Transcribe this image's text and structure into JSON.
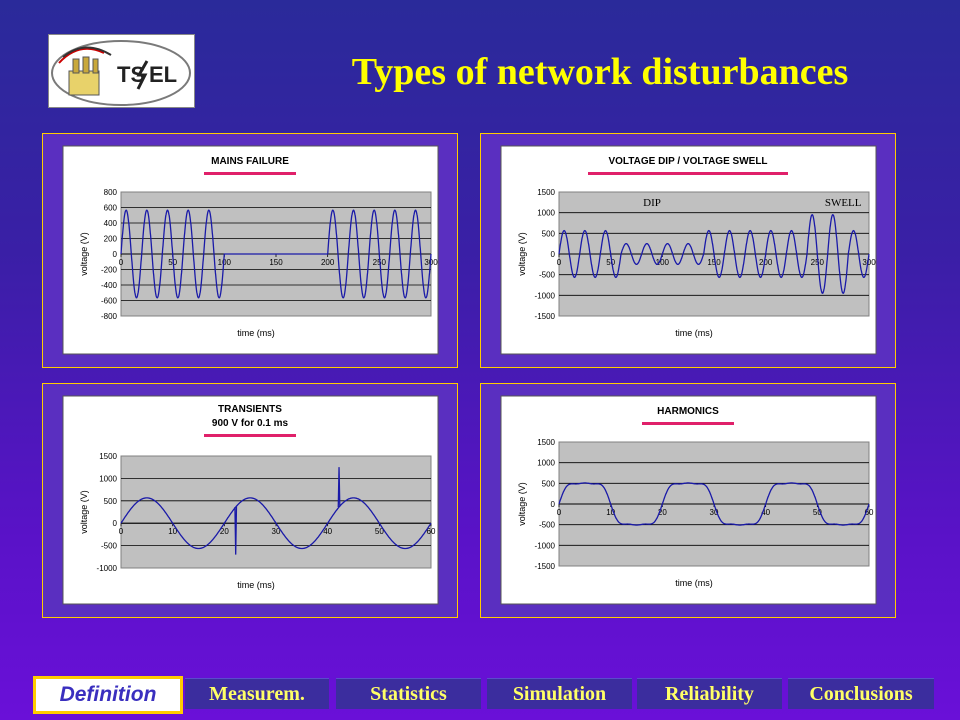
{
  "page": {
    "title": "Types of network disturbances",
    "logo_text": "TS",
    "logo_text2": "EL"
  },
  "nav": {
    "items": [
      "Definition",
      "Measurem.",
      "Statistics",
      "Simulation",
      "Reliability",
      "Conclusions"
    ],
    "active": "Definition"
  },
  "colors": {
    "background": "#4a18c0",
    "title": "#ffff00",
    "curve": "#1a1aa8",
    "title_underline": "#e0206a",
    "plot_area": "#c0c0c0",
    "nav_text": "#ffff66"
  },
  "chart_data": [
    {
      "type": "line",
      "title": "MAINS FAILURE",
      "title2": "",
      "xlabel": "time (ms)",
      "ylabel": "voltage (V)",
      "xlim": [
        0,
        300
      ],
      "ylim": [
        -800,
        800
      ],
      "xticks": [
        0,
        50,
        100,
        150,
        200,
        250,
        300
      ],
      "yticks": [
        800,
        600,
        400,
        200,
        0,
        -200,
        -400,
        -600,
        -800
      ],
      "grid": true,
      "legend": "none",
      "annotations": [],
      "series": [
        {
          "description": "50 Hz sine, amplitude 565 V, 0-100 ms; 0 V from 100 to 200 ms; sine resumes 200-300 ms",
          "frequency_hz": 50,
          "amplitude": 565,
          "segments": [
            [
              0,
              100,
              565
            ],
            [
              100,
              200,
              0
            ],
            [
              200,
              300,
              565
            ]
          ]
        }
      ]
    },
    {
      "type": "line",
      "title": "VOLTAGE DIP / VOLTAGE SWELL",
      "title2": "",
      "xlabel": "time (ms)",
      "ylabel": "voltage (V)",
      "xlim": [
        0,
        300
      ],
      "ylim": [
        -1500,
        1500
      ],
      "xticks": [
        0,
        50,
        100,
        150,
        200,
        250,
        300
      ],
      "yticks": [
        1500,
        1000,
        500,
        0,
        -500,
        -1000,
        -1500
      ],
      "grid": true,
      "legend": "none",
      "annotations": [
        {
          "text": "DIP",
          "x": 90
        },
        {
          "text": "SWELL",
          "x": 275
        }
      ],
      "series": [
        {
          "description": "50 Hz sine: 565 V normal, dip to ~250 V between 60 and 140 ms, normal, swell to ~950 V between 240 and 280 ms",
          "frequency_hz": 50,
          "segments": [
            [
              0,
              60,
              565
            ],
            [
              60,
              140,
              250
            ],
            [
              140,
              240,
              565
            ],
            [
              240,
              280,
              950
            ],
            [
              280,
              300,
              565
            ]
          ]
        }
      ]
    },
    {
      "type": "line",
      "title": "TRANSIENTS",
      "title2": "900 V for 0.1 ms",
      "xlabel": "time (ms)",
      "ylabel": "voltage (V)",
      "xlim": [
        0,
        60
      ],
      "ylim": [
        -1000,
        1500
      ],
      "xticks": [
        0,
        10,
        20,
        30,
        40,
        50,
        60
      ],
      "yticks": [
        1500,
        1000,
        500,
        0,
        -500,
        -1000
      ],
      "grid": true,
      "legend": "none",
      "annotations": [],
      "series": [
        {
          "description": "50 Hz sine, amplitude 565 V, with short spikes near 22 ms and 42 ms (peak ~1250 V)",
          "frequency_hz": 50,
          "amplitude": 565,
          "spikes": [
            [
              22.2,
              -700
            ],
            [
              42.2,
              1250
            ]
          ]
        }
      ]
    },
    {
      "type": "line",
      "title": "HARMONICS",
      "title2": "",
      "xlabel": "time (ms)",
      "ylabel": "voltage (V)",
      "xlim": [
        0,
        60
      ],
      "ylim": [
        -1500,
        1500
      ],
      "xticks": [
        0,
        10,
        20,
        30,
        40,
        50,
        60
      ],
      "yticks": [
        1500,
        1000,
        500,
        0,
        -500,
        -1000,
        -1500
      ],
      "grid": true,
      "legend": "none",
      "annotations": [],
      "series": [
        {
          "description": "distorted 50 Hz wave with 3rd and 5th harmonic content, flattened peaks around +/-500 V",
          "frequency_hz": 50,
          "fundamental": 600,
          "h3": 130,
          "h5": 40
        }
      ]
    }
  ]
}
